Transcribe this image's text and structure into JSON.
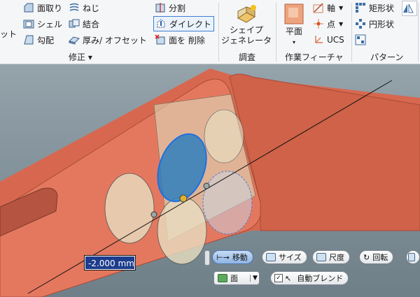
{
  "ribbon": {
    "modify": {
      "label": "修正 ▾",
      "cut_off_text": "ット",
      "items": [
        "面取り",
        "シェル",
        "勾配",
        "ねじ",
        "結合",
        "厚み/ オフセット",
        "分割",
        "ダイレクト",
        "面を 削除"
      ]
    },
    "survey": {
      "label": "調査",
      "shape_generator": "シェイプ\nジェネレータ"
    },
    "work_features": {
      "label": "作業フィーチャ",
      "plane": "平面",
      "plane_arrow": "▾",
      "axis": "軸",
      "point": "点",
      "ucs": "UCS"
    },
    "pattern": {
      "label": "パターン",
      "rectangular": "矩形状",
      "circular": "円形状"
    }
  },
  "minitoolbar": {
    "move": "移動",
    "size": "サイズ",
    "scale": "尺度",
    "rotate": "回転",
    "face": "面",
    "auto_blend": "自動ブレンド",
    "dimension_value": "-2.000 mm"
  },
  "colors": {
    "part": "#e4785f",
    "selected_face": "#2f7fbf",
    "ribbon_bg": "#f5f6f8",
    "viewport_bg": "#7e8f98",
    "active_pill": "#8fb4e4"
  }
}
